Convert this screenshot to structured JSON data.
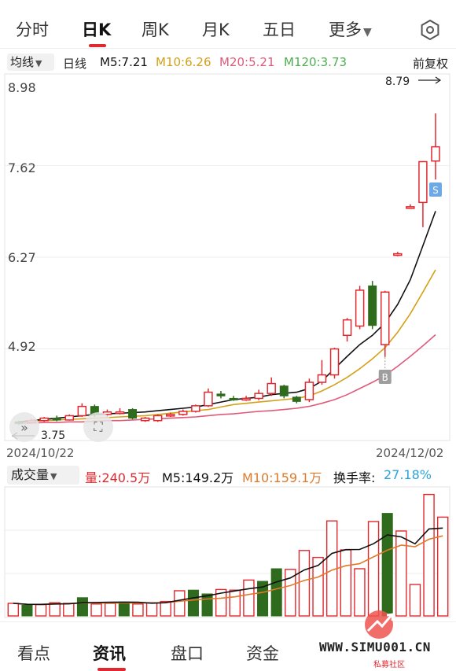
{
  "tabs": {
    "items": [
      {
        "label": "分时",
        "active": false
      },
      {
        "label": "日K",
        "active": true
      },
      {
        "label": "周K",
        "active": false
      },
      {
        "label": "月K",
        "active": false
      },
      {
        "label": "五日",
        "active": false
      },
      {
        "label": "更多",
        "active": false
      }
    ],
    "settings_icon": "hexagon-settings-icon"
  },
  "ma_legend": {
    "selector": "均线",
    "period": "日线",
    "ma5": "M5:7.21",
    "ma10": "M10:6.26",
    "ma20": "M20:5.21",
    "ma120": "M120:3.73",
    "adjust": "前复权",
    "colors": {
      "ma5": "#111111",
      "ma10": "#d4a017",
      "ma20": "#e05a7a",
      "ma120": "#4caf50",
      "up": "#e0292f",
      "down": "#2e6b1c"
    }
  },
  "price_axis": [
    "8.98",
    "7.62",
    "6.27",
    "4.92"
  ],
  "annotations": {
    "high": "8.79",
    "low": "3.75",
    "buy_marker": "B",
    "sell_marker": "S"
  },
  "dates": {
    "start": "2024/10/22",
    "end": "2024/12/02"
  },
  "volume_legend": {
    "selector": "成交量",
    "volume": "量:240.5万",
    "ma5": "M5:149.2万",
    "ma10": "M10:159.1万",
    "turnover_label": "换手率:",
    "turnover_value": "27.18%"
  },
  "bottom_tabs": [
    {
      "label": "看点",
      "active": false
    },
    {
      "label": "资讯",
      "active": true
    },
    {
      "label": "盘口",
      "active": false
    },
    {
      "label": "资金",
      "active": false
    }
  ],
  "watermark": {
    "text": "WWW.SIMU001.CN",
    "sub": "私募社区"
  },
  "chart_data": {
    "type": "candlestick",
    "ylim": [
      3.6,
      9.2
    ],
    "candles": [
      {
        "o": 3.8,
        "c": 3.78,
        "h": 3.82,
        "l": 3.75,
        "dir": "down"
      },
      {
        "o": 3.79,
        "c": 3.82,
        "h": 3.85,
        "l": 3.78,
        "dir": "up"
      },
      {
        "o": 3.82,
        "c": 3.86,
        "h": 3.88,
        "l": 3.8,
        "dir": "up"
      },
      {
        "o": 3.86,
        "c": 3.83,
        "h": 3.9,
        "l": 3.81,
        "dir": "down"
      },
      {
        "o": 3.83,
        "c": 3.9,
        "h": 3.92,
        "l": 3.82,
        "dir": "up"
      },
      {
        "o": 3.9,
        "c": 4.05,
        "h": 4.1,
        "l": 3.88,
        "dir": "up"
      },
      {
        "o": 4.05,
        "c": 3.92,
        "h": 4.08,
        "l": 3.88,
        "dir": "down"
      },
      {
        "o": 3.92,
        "c": 3.96,
        "h": 4.0,
        "l": 3.88,
        "dir": "up"
      },
      {
        "o": 3.96,
        "c": 3.95,
        "h": 4.02,
        "l": 3.92,
        "dir": "up"
      },
      {
        "o": 4.0,
        "c": 3.86,
        "h": 4.02,
        "l": 3.84,
        "dir": "down"
      },
      {
        "o": 3.86,
        "c": 3.82,
        "h": 3.88,
        "l": 3.8,
        "dir": "up"
      },
      {
        "o": 3.82,
        "c": 3.9,
        "h": 3.92,
        "l": 3.8,
        "dir": "up"
      },
      {
        "o": 3.9,
        "c": 3.92,
        "h": 3.95,
        "l": 3.88,
        "dir": "up"
      },
      {
        "o": 3.92,
        "c": 3.97,
        "h": 4.0,
        "l": 3.9,
        "dir": "up"
      },
      {
        "o": 3.97,
        "c": 4.06,
        "h": 4.08,
        "l": 3.95,
        "dir": "up"
      },
      {
        "o": 4.06,
        "c": 4.28,
        "h": 4.34,
        "l": 4.04,
        "dir": "up"
      },
      {
        "o": 4.25,
        "c": 4.22,
        "h": 4.3,
        "l": 4.18,
        "dir": "down"
      },
      {
        "o": 4.18,
        "c": 4.16,
        "h": 4.22,
        "l": 4.14,
        "dir": "down"
      },
      {
        "o": 4.16,
        "c": 4.18,
        "h": 4.22,
        "l": 4.14,
        "dir": "up"
      },
      {
        "o": 4.18,
        "c": 4.26,
        "h": 4.32,
        "l": 4.15,
        "dir": "up"
      },
      {
        "o": 4.26,
        "c": 4.42,
        "h": 4.52,
        "l": 4.22,
        "dir": "up"
      },
      {
        "o": 4.38,
        "c": 4.22,
        "h": 4.4,
        "l": 4.18,
        "dir": "down"
      },
      {
        "o": 4.2,
        "c": 4.13,
        "h": 4.22,
        "l": 4.1,
        "dir": "down"
      },
      {
        "o": 4.16,
        "c": 4.44,
        "h": 4.5,
        "l": 4.12,
        "dir": "up"
      },
      {
        "o": 4.44,
        "c": 4.56,
        "h": 4.8,
        "l": 4.4,
        "dir": "up"
      },
      {
        "o": 4.56,
        "c": 4.98,
        "h": 5.0,
        "l": 4.5,
        "dir": "up"
      },
      {
        "o": 5.2,
        "c": 5.45,
        "h": 5.48,
        "l": 5.1,
        "dir": "up"
      },
      {
        "o": 5.35,
        "c": 5.93,
        "h": 6.0,
        "l": 5.3,
        "dir": "up"
      },
      {
        "o": 6.0,
        "c": 5.36,
        "h": 6.08,
        "l": 5.3,
        "dir": "down"
      },
      {
        "o": 5.9,
        "c": 5.05,
        "h": 5.92,
        "l": 4.85,
        "dir": "up"
      },
      {
        "o": 6.52,
        "c": 6.52,
        "h": 6.55,
        "l": 6.48,
        "dir": "up"
      },
      {
        "o": 7.28,
        "c": 7.28,
        "h": 7.32,
        "l": 7.25,
        "dir": "up"
      },
      {
        "o": 7.35,
        "c": 8.01,
        "h": 8.01,
        "l": 6.95,
        "dir": "up"
      },
      {
        "o": 8.02,
        "c": 8.25,
        "h": 8.79,
        "l": 7.72,
        "dir": "up"
      }
    ],
    "ma5": [
      3.8,
      3.82,
      3.84,
      3.86,
      3.88,
      3.9,
      3.92,
      3.93,
      3.94,
      3.95,
      3.96,
      3.98,
      4.0,
      4.02,
      4.04,
      4.08,
      4.12,
      4.16,
      4.18,
      4.2,
      4.24,
      4.26,
      4.28,
      4.34,
      4.46,
      4.66,
      4.86,
      5.05,
      5.2,
      5.4,
      5.7,
      6.1,
      6.65,
      7.21
    ],
    "ma10": [
      3.8,
      3.81,
      3.82,
      3.83,
      3.84,
      3.85,
      3.86,
      3.87,
      3.88,
      3.89,
      3.9,
      3.92,
      3.94,
      3.96,
      3.98,
      4.0,
      4.04,
      4.08,
      4.1,
      4.12,
      4.14,
      4.16,
      4.18,
      4.22,
      4.3,
      4.4,
      4.52,
      4.66,
      4.82,
      5.0,
      5.25,
      5.55,
      5.9,
      6.26
    ],
    "ma20": [
      3.78,
      3.78,
      3.79,
      3.79,
      3.8,
      3.8,
      3.81,
      3.82,
      3.82,
      3.83,
      3.84,
      3.85,
      3.86,
      3.87,
      3.88,
      3.9,
      3.92,
      3.93,
      3.95,
      3.97,
      3.98,
      4.0,
      4.02,
      4.05,
      4.1,
      4.16,
      4.24,
      4.34,
      4.44,
      4.55,
      4.7,
      4.86,
      5.03,
      5.21
    ],
    "volumes": [
      {
        "v": 0.4,
        "dir": "up"
      },
      {
        "v": 0.34,
        "dir": "down"
      },
      {
        "v": 0.36,
        "dir": "up"
      },
      {
        "v": 0.42,
        "dir": "up"
      },
      {
        "v": 0.4,
        "dir": "up"
      },
      {
        "v": 0.58,
        "dir": "down"
      },
      {
        "v": 0.38,
        "dir": "up"
      },
      {
        "v": 0.4,
        "dir": "up"
      },
      {
        "v": 0.44,
        "dir": "down"
      },
      {
        "v": 0.38,
        "dir": "up"
      },
      {
        "v": 0.42,
        "dir": "up"
      },
      {
        "v": 0.46,
        "dir": "up"
      },
      {
        "v": 0.8,
        "dir": "up"
      },
      {
        "v": 0.82,
        "dir": "down"
      },
      {
        "v": 0.7,
        "dir": "down"
      },
      {
        "v": 0.84,
        "dir": "up"
      },
      {
        "v": 0.82,
        "dir": "up"
      },
      {
        "v": 1.14,
        "dir": "up"
      },
      {
        "v": 1.1,
        "dir": "down"
      },
      {
        "v": 1.5,
        "dir": "down"
      },
      {
        "v": 1.48,
        "dir": "up"
      },
      {
        "v": 2.08,
        "dir": "up"
      },
      {
        "v": 1.86,
        "dir": "up"
      },
      {
        "v": 3.02,
        "dir": "up"
      },
      {
        "v": 2.1,
        "dir": "up"
      },
      {
        "v": 1.5,
        "dir": "up"
      },
      {
        "v": 3.0,
        "dir": "up"
      },
      {
        "v": 3.26,
        "dir": "down"
      },
      {
        "v": 2.7,
        "dir": "up"
      },
      {
        "v": 1.0,
        "dir": "up"
      },
      {
        "v": 3.86,
        "dir": "up"
      },
      {
        "v": 3.14,
        "dir": "up"
      }
    ]
  }
}
